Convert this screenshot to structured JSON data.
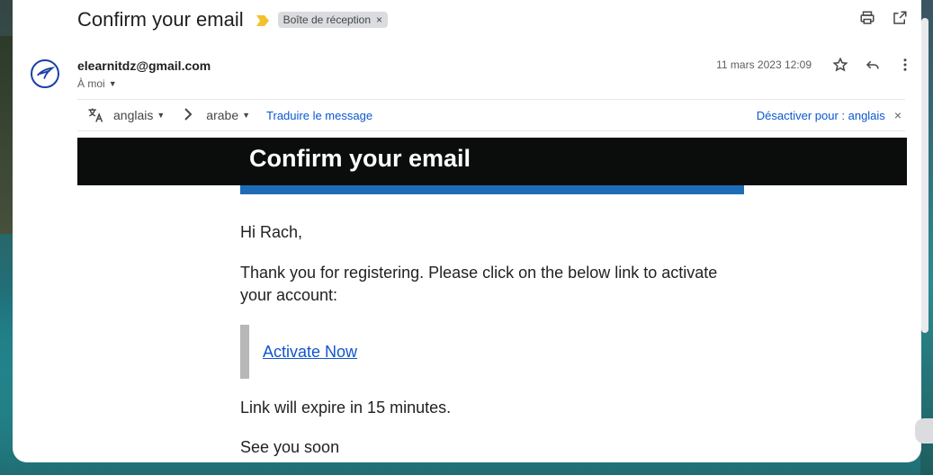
{
  "header": {
    "subject": "Confirm your email",
    "label_chip": "Boîte de réception",
    "chip_close": "×"
  },
  "message": {
    "sender": "elearnitdz@gmail.com",
    "recipient": "À moi",
    "date": "11 mars 2023 12:09"
  },
  "translate": {
    "source_lang": "anglais",
    "target_lang": "arabe",
    "translate_link": "Traduire le message",
    "disable_link": "Désactiver pour : anglais",
    "close": "×"
  },
  "body": {
    "banner_title": "Confirm your email",
    "greeting": "Hi Rach,",
    "paragraph": "Thank you for registering. Please click on the below link to activate your account:",
    "activate_link": "Activate Now",
    "expire_text": "Link will expire in 15 minutes.",
    "closing": "See you soon"
  },
  "icons": {
    "importance": "importance-marker-icon",
    "print": "print-icon",
    "open_new": "open-in-new-window-icon",
    "star": "star-icon",
    "reply": "reply-icon",
    "more": "more-vert-icon",
    "translate": "translate-icon",
    "avatar": "sender-logo-icon"
  },
  "colors": {
    "importance": "#f2c12e",
    "link": "#0b57d0",
    "banner_bg": "#0b0d0d",
    "blue_bar": "#1e6cb6",
    "quote_bar": "#b7b7b7"
  }
}
